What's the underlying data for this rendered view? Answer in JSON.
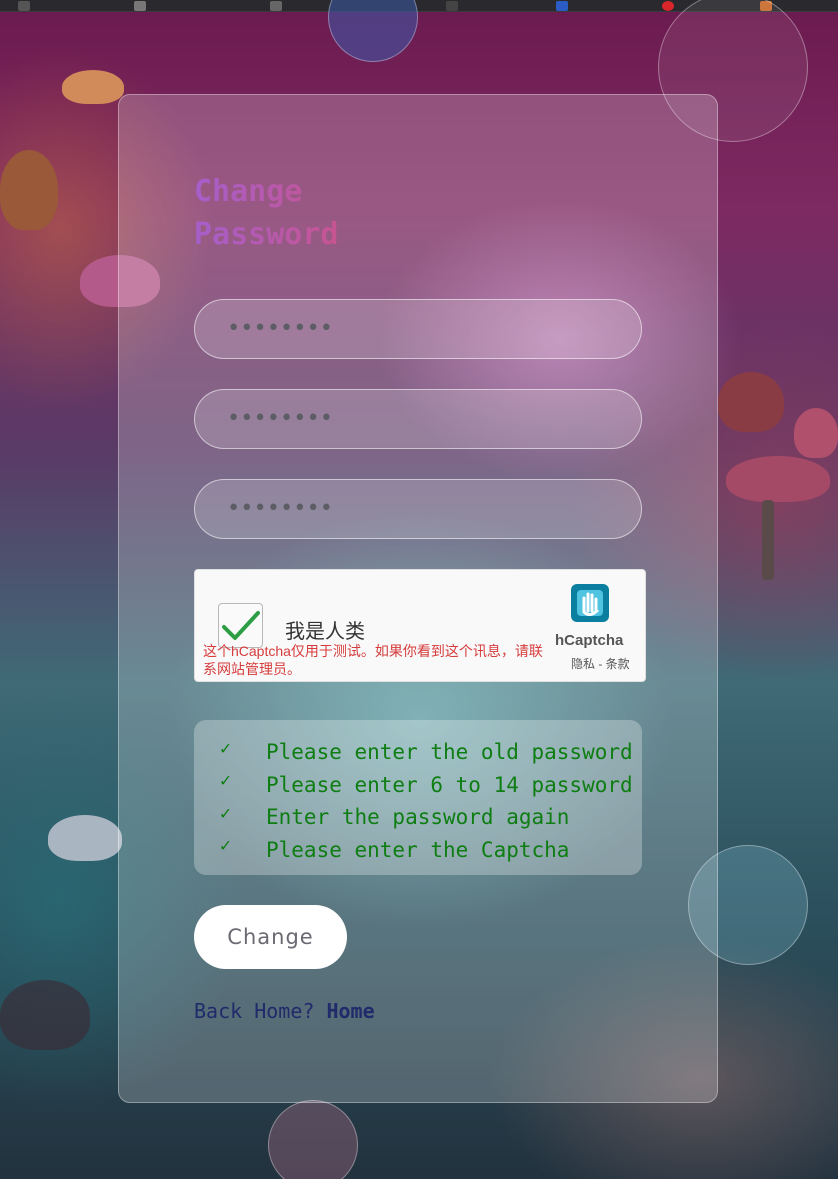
{
  "page": {
    "title_line1": "Change",
    "title_line2": "Password"
  },
  "form": {
    "old_password_mask": "••••••••",
    "new_password_mask": "••••••••",
    "confirm_password_mask": "••••••••"
  },
  "captcha": {
    "label": "我是人类",
    "warning": "这个hCaptcha仅用于测试。如果你看到这个讯息，请联系网站管理员。",
    "brand": "hCaptcha",
    "links": "隐私 - 条款",
    "checked": true
  },
  "rules": [
    {
      "icon": "check-icon",
      "text": "Please enter the old password"
    },
    {
      "icon": "check-icon",
      "text": "Please enter 6 to 14 password"
    },
    {
      "icon": "check-icon",
      "text": "Enter the password again"
    },
    {
      "icon": "check-icon",
      "text": "Please enter the Captcha"
    }
  ],
  "actions": {
    "change_label": "Change",
    "back_prefix": "Back Home?",
    "back_link": "Home"
  },
  "colors": {
    "rule_green": "#0e7d12",
    "link_navy": "#1f2b6a",
    "title_gradient_start": "#a55fcb",
    "title_gradient_end": "#d4507a"
  }
}
